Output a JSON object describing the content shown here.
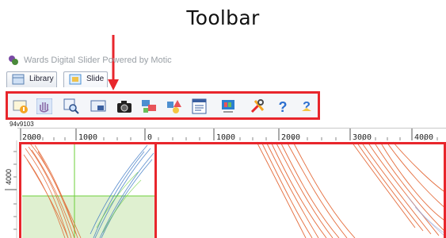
{
  "annotation": {
    "title": "Toolbar"
  },
  "app": {
    "title": "Wards Digital Slider Powered by Motic"
  },
  "tabs": [
    {
      "label": "Library",
      "icon": "library-icon"
    },
    {
      "label": "Slide",
      "icon": "slide-icon"
    }
  ],
  "toolbar": {
    "buttons": [
      {
        "icon": "image-info-icon"
      },
      {
        "icon": "hand-pan-icon"
      },
      {
        "icon": "zoom-magnifier-icon"
      },
      {
        "icon": "overview-map-icon"
      },
      {
        "icon": "camera-icon"
      },
      {
        "icon": "compare-images-icon"
      },
      {
        "icon": "annotation-shapes-icon"
      },
      {
        "icon": "slide-list-icon"
      },
      {
        "icon": "display-adjust-icon"
      },
      {
        "icon": "tools-settings-icon"
      },
      {
        "icon": "help-icon"
      },
      {
        "icon": "context-help-icon"
      }
    ]
  },
  "document": {
    "label": "94v9103"
  },
  "ruler": {
    "top_ticks": [
      "2000",
      "1000",
      "0",
      "1000",
      "2000",
      "3000",
      "4000"
    ],
    "left_label": "4000"
  },
  "colors": {
    "highlight": "#e8262c",
    "nav_fill": "#dff0d0",
    "trace_red": "#e0541c",
    "trace_blue": "#2e6fc0"
  }
}
